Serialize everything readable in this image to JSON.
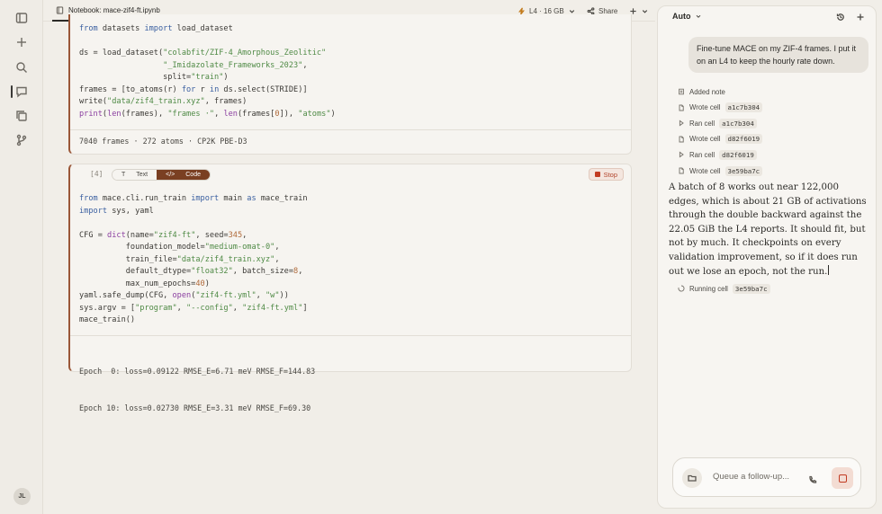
{
  "rail": {
    "avatar_initials": "JL"
  },
  "topbar": {
    "tab_title": "Notebook: mace-zif4-ft.ipynb",
    "gpu_label": "L4 · 16 GB",
    "share_label": "Share"
  },
  "cell1": {
    "code_lines": [
      "from datasets import load_dataset",
      "",
      "ds = load_dataset(\"colabfit/ZIF-4_Amorphous_Zeolitic\"",
      "                  \"_Imidazolate_Frameworks_2023\",",
      "                  split=\"train\")",
      "frames = [to_atoms(r) for r in ds.select(STRIDE)]",
      "write(\"data/zif4_train.xyz\", frames)",
      "print(len(frames), \"frames ·\", len(frames[0]), \"atoms\")"
    ],
    "output": "7040 frames · 272 atoms · CP2K PBE-D3"
  },
  "cell2": {
    "exec_count": "[4]",
    "toggle_text": "Text",
    "toggle_code": "Code",
    "stop_label": "Stop",
    "code_lines": [
      "from mace.cli.run_train import main as mace_train",
      "import sys, yaml",
      "",
      "CFG = dict(name=\"zif4-ft\", seed=345,",
      "          foundation_model=\"medium-omat-0\",",
      "          train_file=\"data/zif4_train.xyz\",",
      "          default_dtype=\"float32\", batch_size=8,",
      "          max_num_epochs=40)",
      "yaml.safe_dump(CFG, open(\"zif4-ft.yml\", \"w\"))",
      "sys.argv = [\"program\", \"--config\", \"zif4-ft.yml\"]",
      "mace_train()"
    ],
    "output_lines": [
      "Epoch  0: loss=0.09122 RMSE_E=6.71 meV RMSE_F=144.83",
      "Epoch 10: loss=0.02730 RMSE_E=3.31 meV RMSE_F=69.30"
    ]
  },
  "panel": {
    "mode_label": "Auto",
    "user_message": "Fine-tune MACE on my ZIF-4 frames. I put it on an L4 to keep the hourly rate down.",
    "steps": [
      {
        "label": "Added note",
        "code": "",
        "icon": "note-icon"
      },
      {
        "label": "Wrote cell",
        "code": "a1c7b304",
        "icon": "file-icon"
      },
      {
        "label": "Ran cell",
        "code": "a1c7b304",
        "icon": "play-icon"
      },
      {
        "label": "Wrote cell",
        "code": "d82f6019",
        "icon": "file-icon"
      },
      {
        "label": "Ran cell",
        "code": "d82f6019",
        "icon": "play-icon"
      },
      {
        "label": "Wrote cell",
        "code": "3e59ba7c",
        "icon": "file-icon"
      }
    ],
    "assistant_message": "A batch of 8 works out near 122,000 edges, which is about 21 GB of activations through the double backward against the 22.05 GiB the L4 reports. It should fit, but not by much. It checkpoints on every validation improvement, so if it does run out we lose an epoch, not the run.",
    "running_label": "Running cell",
    "running_code": "3e59ba7c",
    "composer_placeholder": "Queue a follow-up..."
  }
}
